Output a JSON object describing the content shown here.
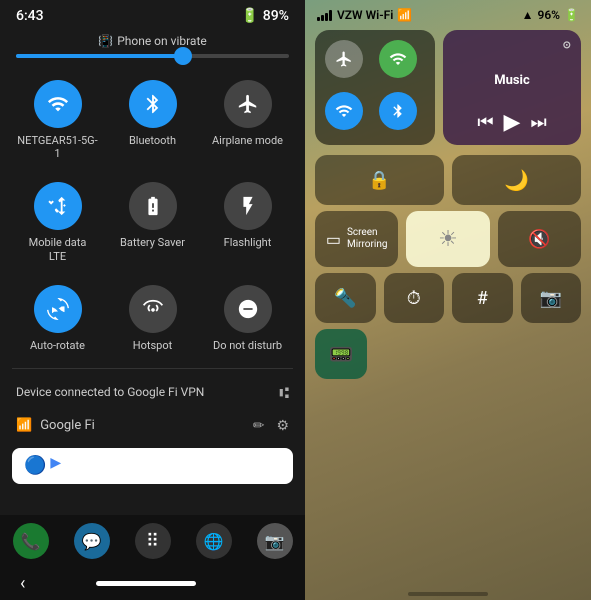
{
  "android": {
    "status_time": "6:43",
    "battery": "89%",
    "vibrate_label": "Phone on vibrate",
    "tiles": [
      {
        "id": "wifi",
        "label": "NETGEAR51-5G-1",
        "active": true,
        "icon": "▼"
      },
      {
        "id": "bluetooth",
        "label": "Bluetooth",
        "active": true,
        "icon": "⬡"
      },
      {
        "id": "airplane",
        "label": "Airplane mode",
        "active": false,
        "icon": "✈"
      },
      {
        "id": "mobile",
        "label": "Mobile data\nLTE",
        "active": true,
        "icon": "↕"
      },
      {
        "id": "battery_saver",
        "label": "Battery Saver",
        "active": false,
        "icon": "⬜"
      },
      {
        "id": "flashlight",
        "label": "Flashlight",
        "active": false,
        "icon": "☁"
      },
      {
        "id": "rotate",
        "label": "Auto-rotate",
        "active": true,
        "icon": "↺"
      },
      {
        "id": "hotspot",
        "label": "Hotspot",
        "active": false,
        "icon": "⊙"
      },
      {
        "id": "dnd",
        "label": "Do not disturb",
        "active": false,
        "icon": "⊖"
      }
    ],
    "vpn_text": "Device connected to Google Fi VPN",
    "network_name": "Google Fi",
    "nav_apps": [
      "📞",
      "💬",
      "⠿",
      "🌐",
      "📷"
    ],
    "back_label": "‹"
  },
  "ios": {
    "carrier": "VZW Wi-Fi",
    "battery": "96%",
    "music_label": "Music",
    "screen_mirroring": "Screen\nMirroring"
  }
}
